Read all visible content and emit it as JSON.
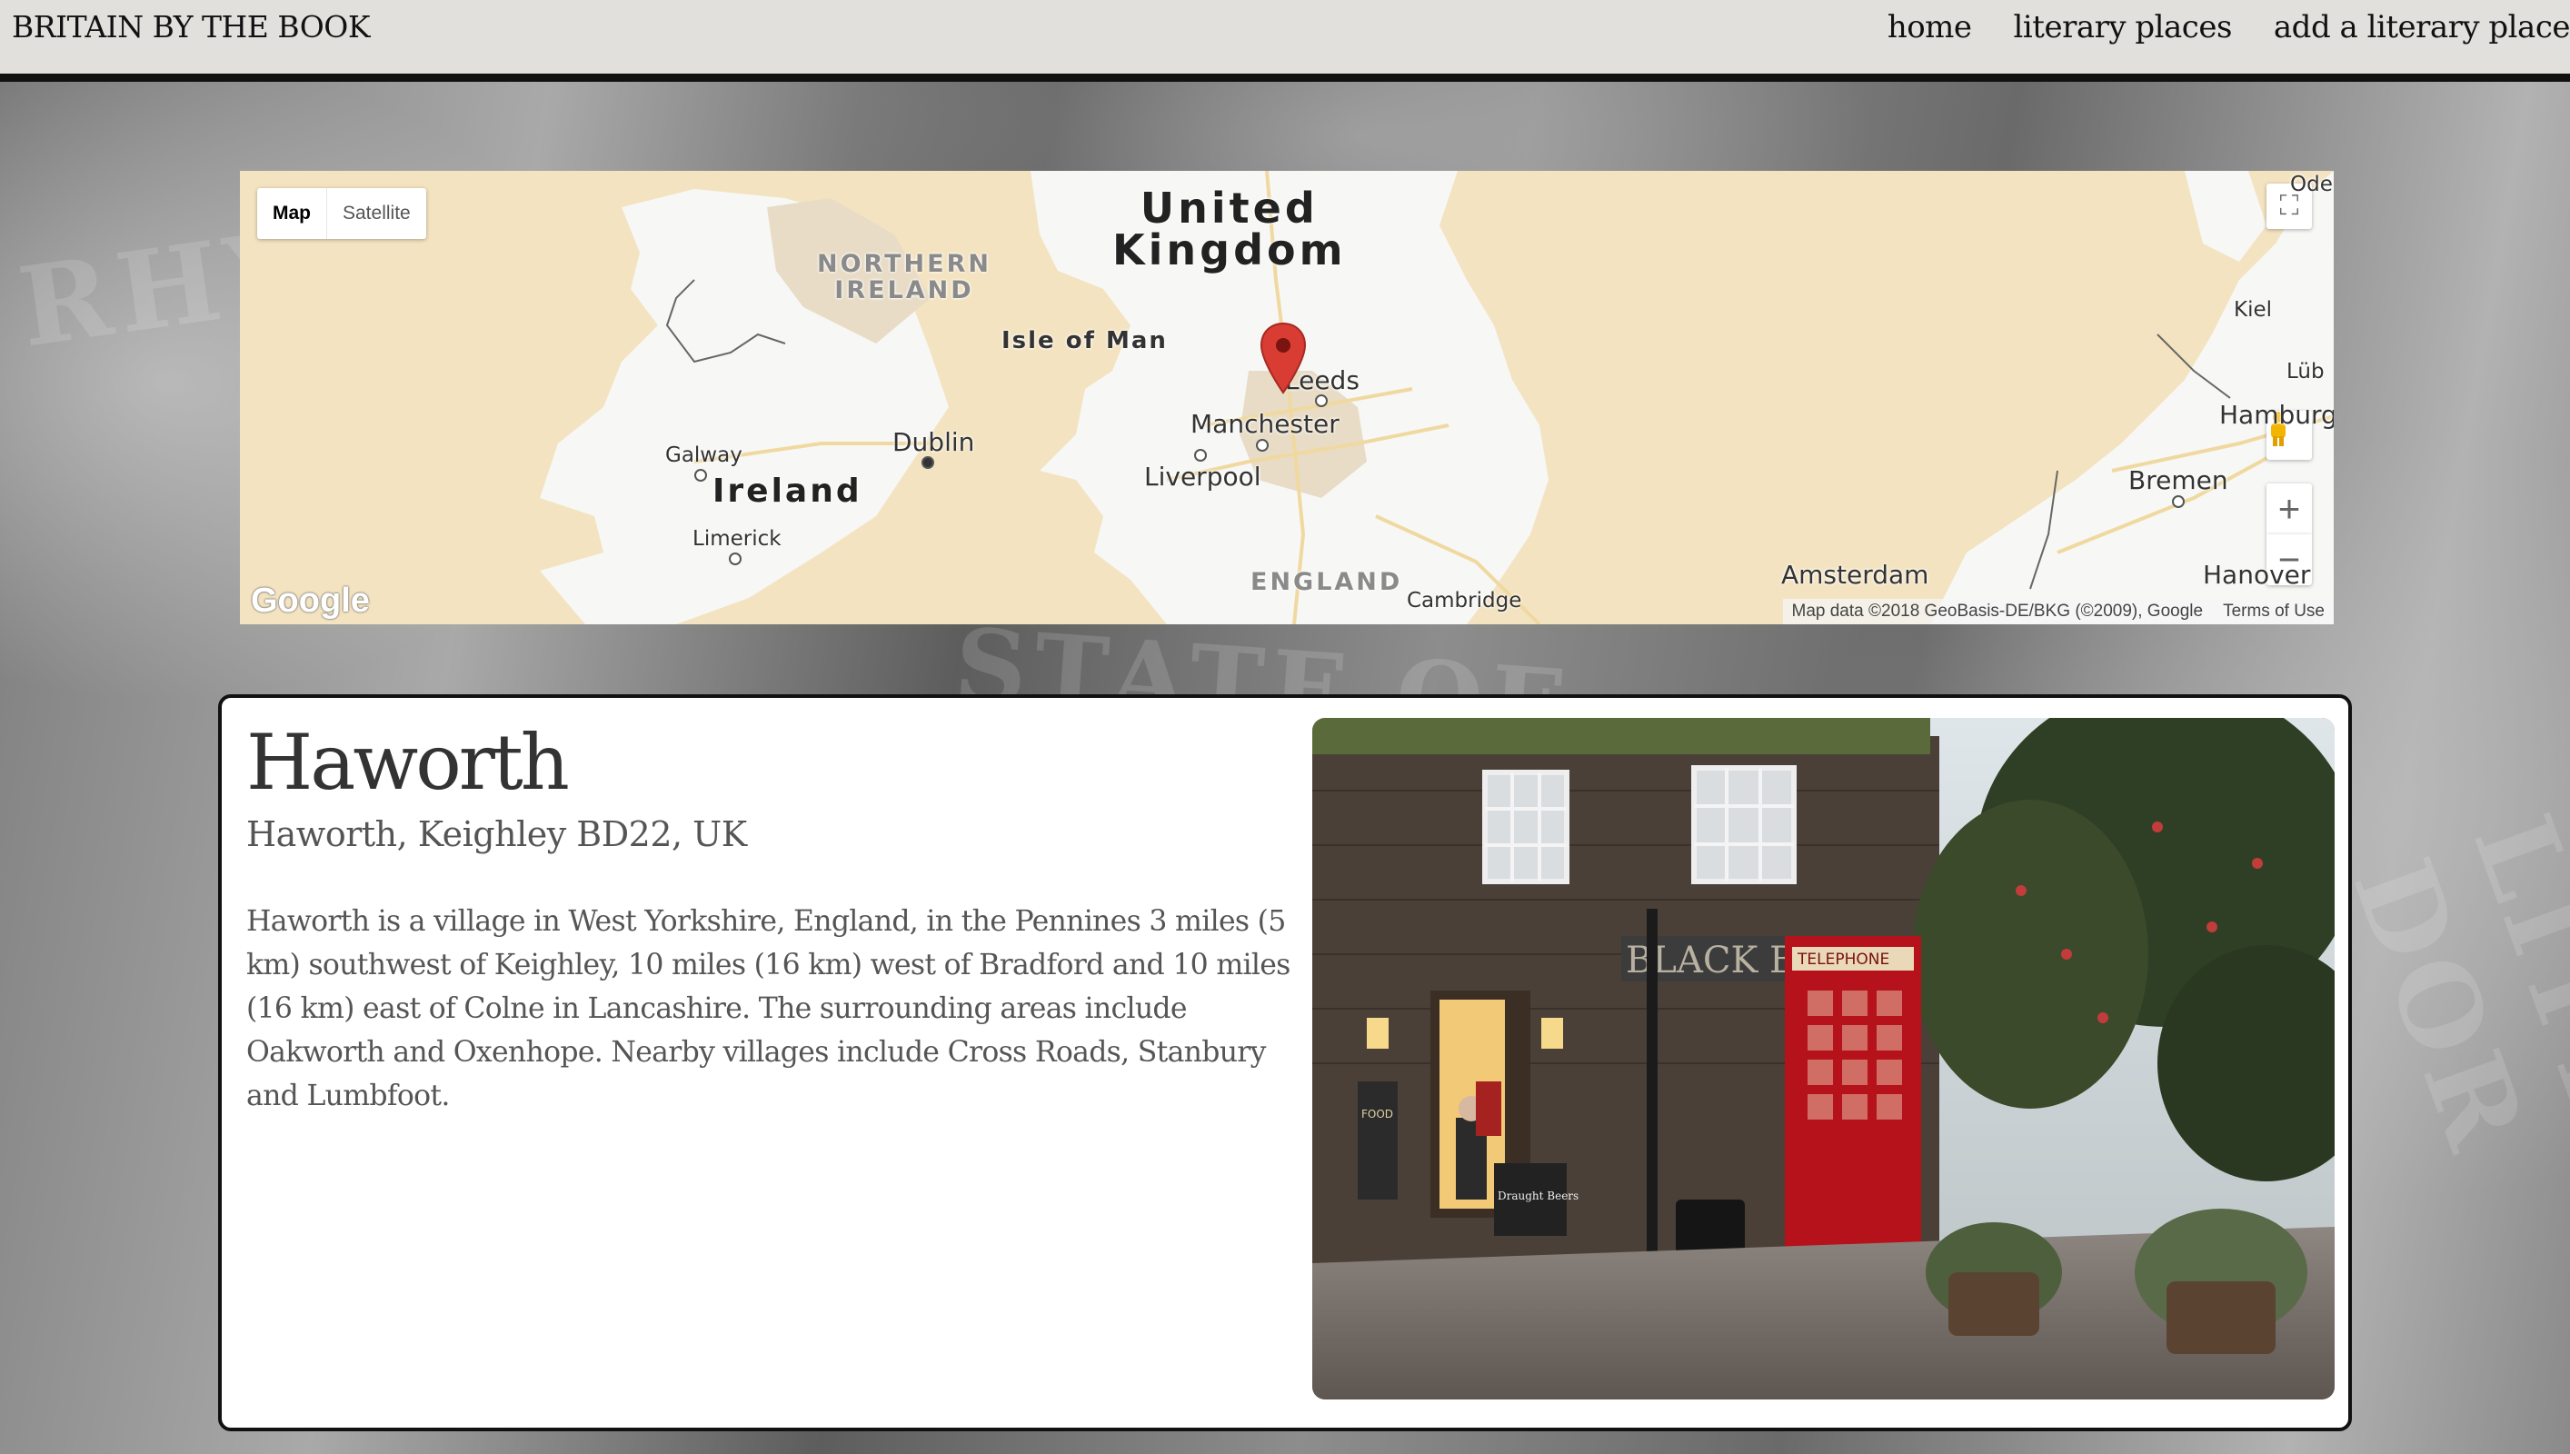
{
  "nav": {
    "brand": "BRITAIN BY THE BOOK",
    "links": [
      "home",
      "literary places",
      "add a literary place"
    ]
  },
  "map": {
    "type_map": "Map",
    "type_satellite": "Satellite",
    "labels": {
      "uk_line1": "United",
      "uk_line2": "Kingdom",
      "ni_line1": "NORTHERN",
      "ni_line2": "IRELAND",
      "isle_of_man": "Isle of Man",
      "leeds": "Leeds",
      "manchester": "Manchester",
      "liverpool": "Liverpool",
      "dublin": "Dublin",
      "galway": "Galway",
      "ireland": "Ireland",
      "limerick": "Limerick",
      "england": "ENGLAND",
      "cambridge": "Cambridge",
      "amsterdam": "Amsterdam",
      "bremen": "Bremen",
      "hamburg": "Hamburg",
      "hanover": "Hanover",
      "kiel": "Kiel",
      "lub": "Lüb",
      "odens": "Odens"
    },
    "logo": "Google",
    "attribution": "Map data ©2018 GeoBasis-DE/BKG (©2009), Google",
    "terms": "Terms of Use",
    "zoom_in": "+",
    "zoom_out": "−",
    "marker_color": "#d93c32",
    "land_color": "#f3e3c0",
    "sea_color": "#f6f6f4"
  },
  "place": {
    "name": "Haworth",
    "address": "Haworth, Keighley BD22, UK",
    "description": "Haworth is a village in West Yorkshire, England, in the Pennines 3 miles (5 km) southwest of Keighley, 10 miles (16 km) west of Bradford and 10 miles (16 km) east of Colne in Lancashire. The surrounding areas include Oakworth and Oxenhope. Nearby villages include Cross Roads, Stanbury and Lumbfoot.",
    "photo_signs": {
      "shop": "BLACK BULL",
      "phone_box": "TELEPHONE",
      "food": "FOOD",
      "board": "Draught Beers"
    }
  }
}
